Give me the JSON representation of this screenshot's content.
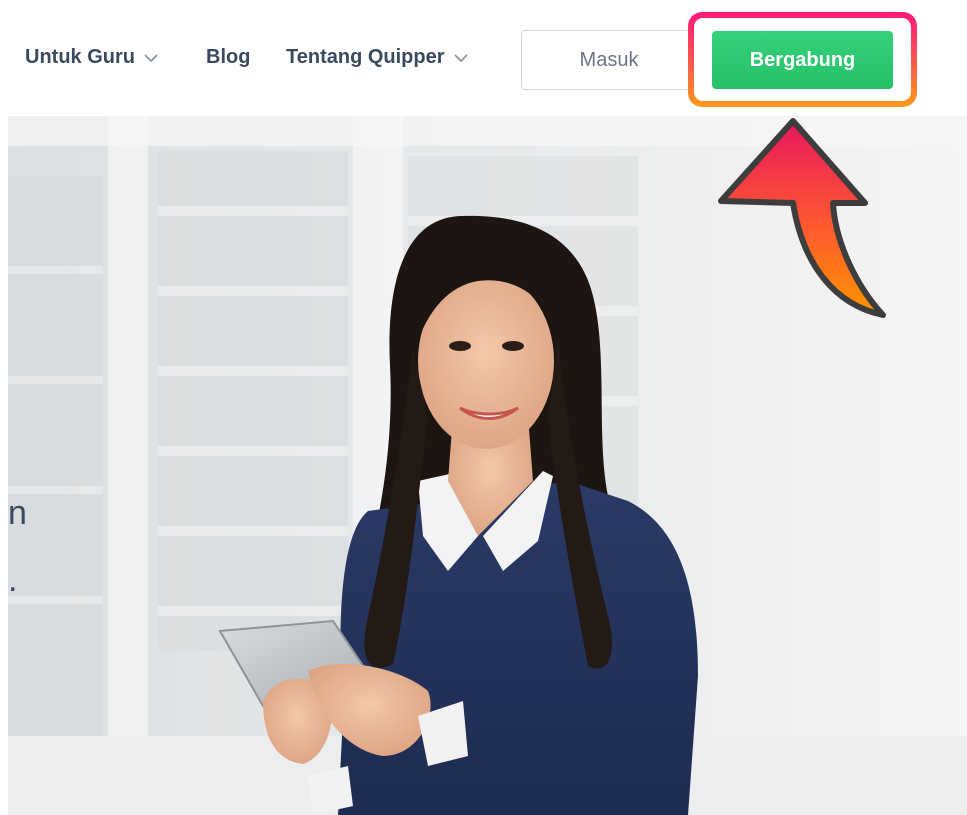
{
  "nav": {
    "items": [
      {
        "label": "Untuk Guru",
        "has_dropdown": true
      },
      {
        "label": "Blog",
        "has_dropdown": false
      },
      {
        "label": "Tentang Quipper",
        "has_dropdown": true
      }
    ],
    "login_label": "Masuk",
    "join_label": "Bergabung"
  },
  "hero": {
    "partial_text_line1": "n",
    "partial_text_line2": "."
  },
  "annotation": {
    "highlight": "Bergabung button highlighted",
    "arrow_icon": "curved-up-arrow-icon"
  },
  "colors": {
    "nav_text": "#3a4a5f",
    "join_button": "#2ecc71",
    "highlight_gradient_top": "#ff1a7a",
    "highlight_gradient_bottom": "#ff9a1a",
    "arrow_gradient_top": "#e8175d",
    "arrow_gradient_bottom": "#ff9500",
    "arrow_outline": "#3d3d3d"
  }
}
